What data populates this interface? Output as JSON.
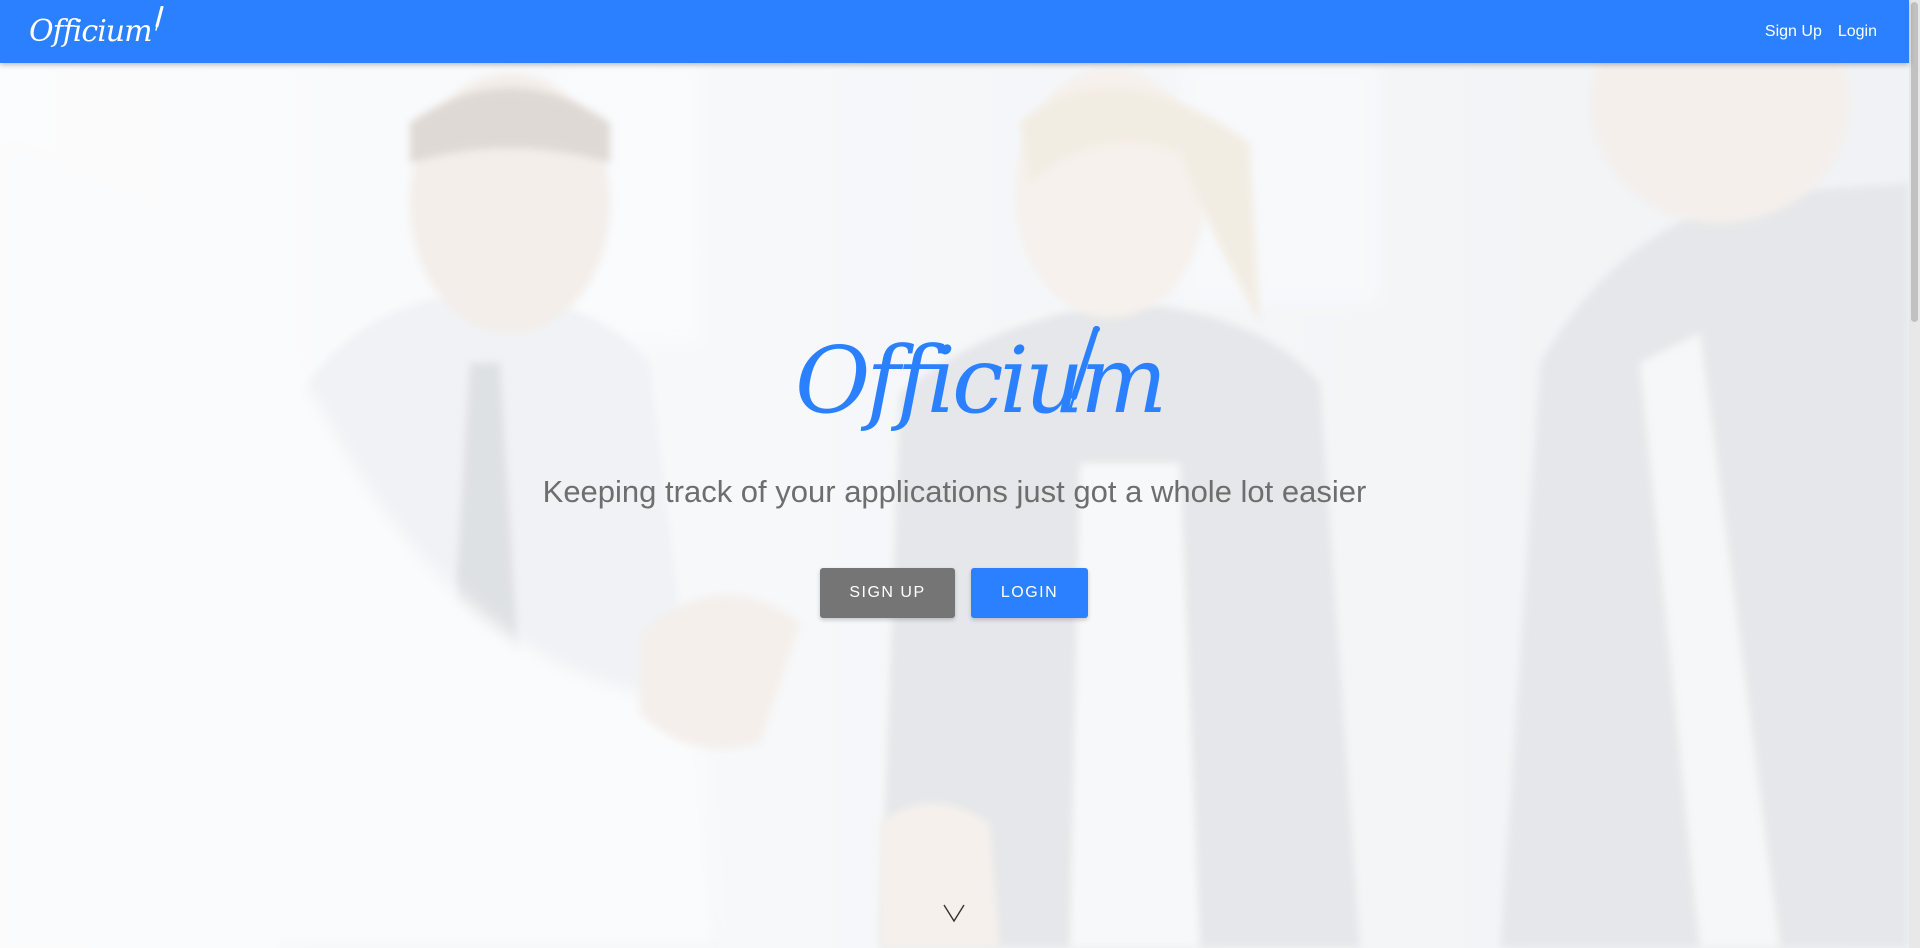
{
  "navbar": {
    "brand": "Officium",
    "links": {
      "signup": "Sign Up",
      "login": "Login"
    }
  },
  "hero": {
    "logo": "Officium",
    "tagline": "Keeping track of your applications just got a whole lot easier",
    "buttons": {
      "signup": "SIGN UP",
      "login": "LOGIN"
    },
    "scroll_icon": "chevron-down-icon"
  },
  "colors": {
    "primary": "#2b80ff",
    "secondary_button": "#757575",
    "tagline_text": "#6e6e6e"
  }
}
